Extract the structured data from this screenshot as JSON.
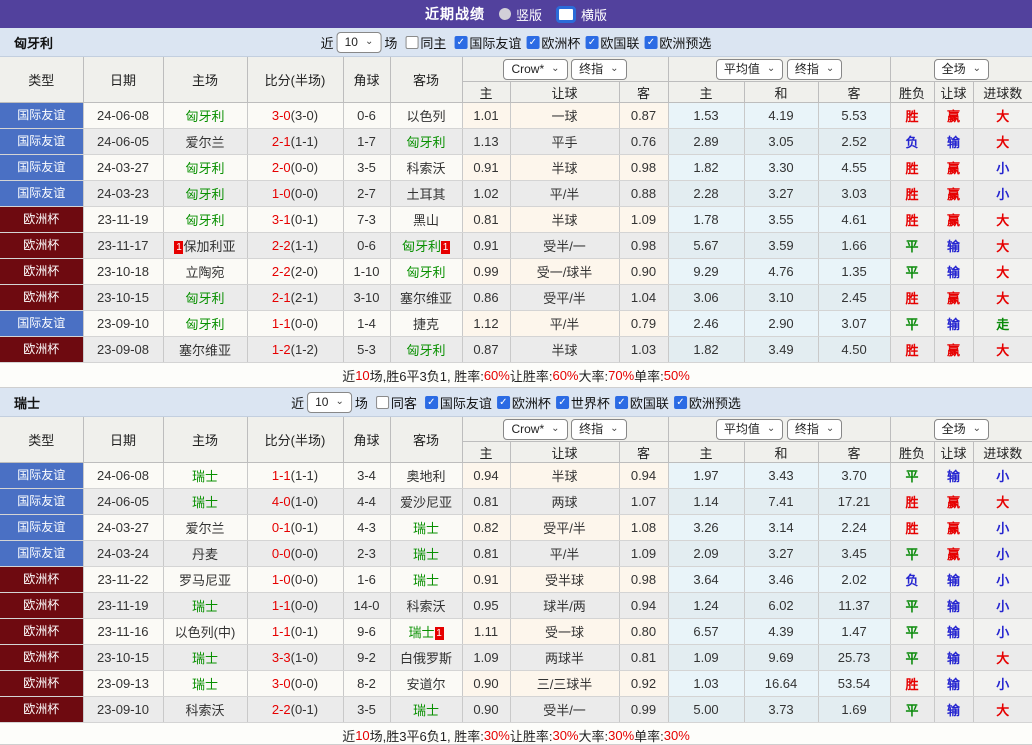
{
  "topbar": {
    "title": "近期战绩",
    "radio_vertical": "竖版",
    "radio_horizontal": "横版",
    "selected": "横版"
  },
  "colors": {
    "topbar_purple": "#52419d",
    "filter_bg": "#dbe5f2",
    "badge_friendly_blue": "#4a70c4",
    "badge_eurocup_darkred": "#6e0a10",
    "win_red": "#e60000",
    "lose_blue": "#2525d0",
    "draw_green": "#0a8a0a",
    "team_green": "#089000",
    "avg_col_blue": "#e9f4f9"
  },
  "header_labels": {
    "static_cols": [
      "类型",
      "日期",
      "主场",
      "比分(半场)",
      "角球",
      "客场"
    ],
    "crow_select": "Crow*",
    "crow_final_select": "终指",
    "crow_subcols": [
      "主",
      "让球",
      "客"
    ],
    "avg_select": "平均值",
    "avg_final_select": "终指",
    "avg_subcols": [
      "主",
      "和",
      "客"
    ],
    "full_select": "全场",
    "result_subcols": [
      "胜负",
      "让球",
      "进球数"
    ]
  },
  "sections": [
    {
      "team": "匈牙利",
      "filter": {
        "near_label": "近",
        "count_value": "10",
        "games_label": "场",
        "same_label": "同主",
        "same_checked": false,
        "competitions": [
          "国际友谊",
          "欧洲杯",
          "欧国联",
          "欧洲预选"
        ]
      },
      "rows": [
        {
          "type": "国际友谊",
          "style": "blue",
          "date": "24-06-08",
          "home": "匈牙利",
          "home_green": true,
          "home_card": "",
          "score": "3-0",
          "half": "(3-0)",
          "corner": "0-6",
          "away": "以色列",
          "away_green": false,
          "away_card": "",
          "crow": [
            "1.01",
            "一球",
            "0.87"
          ],
          "avg": [
            "1.53",
            "4.19",
            "5.53"
          ],
          "results": [
            [
              "胜",
              "r"
            ],
            [
              "赢",
              "r"
            ],
            [
              "大",
              "r"
            ]
          ]
        },
        {
          "type": "国际友谊",
          "style": "blue",
          "date": "24-06-05",
          "home": "爱尔兰",
          "home_green": false,
          "home_card": "",
          "score": "2-1",
          "half": "(1-1)",
          "corner": "1-7",
          "away": "匈牙利",
          "away_green": true,
          "away_card": "",
          "crow": [
            "1.13",
            "平手",
            "0.76"
          ],
          "avg": [
            "2.89",
            "3.05",
            "2.52"
          ],
          "results": [
            [
              "负",
              "b"
            ],
            [
              "输",
              "b"
            ],
            [
              "大",
              "r"
            ]
          ]
        },
        {
          "type": "国际友谊",
          "style": "blue",
          "date": "24-03-27",
          "home": "匈牙利",
          "home_green": true,
          "home_card": "",
          "score": "2-0",
          "half": "(0-0)",
          "corner": "3-5",
          "away": "科索沃",
          "away_green": false,
          "away_card": "",
          "crow": [
            "0.91",
            "半球",
            "0.98"
          ],
          "avg": [
            "1.82",
            "3.30",
            "4.55"
          ],
          "results": [
            [
              "胜",
              "r"
            ],
            [
              "赢",
              "r"
            ],
            [
              "小",
              "b"
            ]
          ]
        },
        {
          "type": "国际友谊",
          "style": "blue",
          "date": "24-03-23",
          "home": "匈牙利",
          "home_green": true,
          "home_card": "",
          "score": "1-0",
          "half": "(0-0)",
          "corner": "2-7",
          "away": "土耳其",
          "away_green": false,
          "away_card": "",
          "crow": [
            "1.02",
            "平/半",
            "0.88"
          ],
          "avg": [
            "2.28",
            "3.27",
            "3.03"
          ],
          "results": [
            [
              "胜",
              "r"
            ],
            [
              "赢",
              "r"
            ],
            [
              "小",
              "b"
            ]
          ]
        },
        {
          "type": "欧洲杯",
          "style": "darkred",
          "date": "23-11-19",
          "home": "匈牙利",
          "home_green": true,
          "home_card": "",
          "score": "3-1",
          "half": "(0-1)",
          "corner": "7-3",
          "away": "黑山",
          "away_green": false,
          "away_card": "",
          "crow": [
            "0.81",
            "半球",
            "1.09"
          ],
          "avg": [
            "1.78",
            "3.55",
            "4.61"
          ],
          "results": [
            [
              "胜",
              "r"
            ],
            [
              "赢",
              "r"
            ],
            [
              "大",
              "r"
            ]
          ]
        },
        {
          "type": "欧洲杯",
          "style": "darkred",
          "date": "23-11-17",
          "home": "保加利亚",
          "home_green": false,
          "home_card": "1",
          "score": "2-2",
          "half": "(1-1)",
          "corner": "0-6",
          "away": "匈牙利",
          "away_green": true,
          "away_card": "1",
          "crow": [
            "0.91",
            "受半/一",
            "0.98"
          ],
          "avg": [
            "5.67",
            "3.59",
            "1.66"
          ],
          "results": [
            [
              "平",
              "g"
            ],
            [
              "输",
              "b"
            ],
            [
              "大",
              "r"
            ]
          ]
        },
        {
          "type": "欧洲杯",
          "style": "darkred",
          "date": "23-10-18",
          "home": "立陶宛",
          "home_green": false,
          "home_card": "",
          "score": "2-2",
          "half": "(2-0)",
          "corner": "1-10",
          "away": "匈牙利",
          "away_green": true,
          "away_card": "",
          "crow": [
            "0.99",
            "受一/球半",
            "0.90"
          ],
          "avg": [
            "9.29",
            "4.76",
            "1.35"
          ],
          "results": [
            [
              "平",
              "g"
            ],
            [
              "输",
              "b"
            ],
            [
              "大",
              "r"
            ]
          ]
        },
        {
          "type": "欧洲杯",
          "style": "darkred",
          "date": "23-10-15",
          "home": "匈牙利",
          "home_green": true,
          "home_card": "",
          "score": "2-1",
          "half": "(2-1)",
          "corner": "3-10",
          "away": "塞尔维亚",
          "away_green": false,
          "away_card": "",
          "crow": [
            "0.86",
            "受平/半",
            "1.04"
          ],
          "avg": [
            "3.06",
            "3.10",
            "2.45"
          ],
          "results": [
            [
              "胜",
              "r"
            ],
            [
              "赢",
              "r"
            ],
            [
              "大",
              "r"
            ]
          ]
        },
        {
          "type": "国际友谊",
          "style": "blue",
          "date": "23-09-10",
          "home": "匈牙利",
          "home_green": true,
          "home_card": "",
          "score": "1-1",
          "half": "(0-0)",
          "corner": "1-4",
          "away": "捷克",
          "away_green": false,
          "away_card": "",
          "crow": [
            "1.12",
            "平/半",
            "0.79"
          ],
          "avg": [
            "2.46",
            "2.90",
            "3.07"
          ],
          "results": [
            [
              "平",
              "g"
            ],
            [
              "输",
              "b"
            ],
            [
              "走",
              "g"
            ]
          ]
        },
        {
          "type": "欧洲杯",
          "style": "darkred",
          "date": "23-09-08",
          "home": "塞尔维亚",
          "home_green": false,
          "home_card": "",
          "score": "1-2",
          "half": "(1-2)",
          "corner": "5-3",
          "away": "匈牙利",
          "away_green": true,
          "away_card": "",
          "crow": [
            "0.87",
            "半球",
            "1.03"
          ],
          "avg": [
            "1.82",
            "3.49",
            "4.50"
          ],
          "results": [
            [
              "胜",
              "r"
            ],
            [
              "赢",
              "r"
            ],
            [
              "大",
              "r"
            ]
          ]
        }
      ],
      "summary": [
        [
          "近",
          0
        ],
        [
          "10",
          1
        ],
        [
          "场,胜6平3负1, 胜率:",
          0
        ],
        [
          "60%",
          1
        ],
        [
          " 让胜率:",
          0
        ],
        [
          "60%",
          1
        ],
        [
          " 大率:",
          0
        ],
        [
          "70%",
          1
        ],
        [
          " 单率:",
          0
        ],
        [
          "50%",
          1
        ]
      ]
    },
    {
      "team": "瑞士",
      "filter": {
        "near_label": "近",
        "count_value": "10",
        "games_label": "场",
        "same_label": "同客",
        "same_checked": false,
        "competitions": [
          "国际友谊",
          "欧洲杯",
          "世界杯",
          "欧国联",
          "欧洲预选"
        ]
      },
      "rows": [
        {
          "type": "国际友谊",
          "style": "blue",
          "date": "24-06-08",
          "home": "瑞士",
          "home_green": true,
          "home_card": "",
          "score": "1-1",
          "half": "(1-1)",
          "corner": "3-4",
          "away": "奥地利",
          "away_green": false,
          "away_card": "",
          "crow": [
            "0.94",
            "半球",
            "0.94"
          ],
          "avg": [
            "1.97",
            "3.43",
            "3.70"
          ],
          "results": [
            [
              "平",
              "g"
            ],
            [
              "输",
              "b"
            ],
            [
              "小",
              "b"
            ]
          ]
        },
        {
          "type": "国际友谊",
          "style": "blue",
          "date": "24-06-05",
          "home": "瑞士",
          "home_green": true,
          "home_card": "",
          "score": "4-0",
          "half": "(1-0)",
          "corner": "4-4",
          "away": "爱沙尼亚",
          "away_green": false,
          "away_card": "",
          "crow": [
            "0.81",
            "两球",
            "1.07"
          ],
          "avg": [
            "1.14",
            "7.41",
            "17.21"
          ],
          "results": [
            [
              "胜",
              "r"
            ],
            [
              "赢",
              "r"
            ],
            [
              "大",
              "r"
            ]
          ]
        },
        {
          "type": "国际友谊",
          "style": "blue",
          "date": "24-03-27",
          "home": "爱尔兰",
          "home_green": false,
          "home_card": "",
          "score": "0-1",
          "half": "(0-1)",
          "corner": "4-3",
          "away": "瑞士",
          "away_green": true,
          "away_card": "",
          "crow": [
            "0.82",
            "受平/半",
            "1.08"
          ],
          "avg": [
            "3.26",
            "3.14",
            "2.24"
          ],
          "results": [
            [
              "胜",
              "r"
            ],
            [
              "赢",
              "r"
            ],
            [
              "小",
              "b"
            ]
          ]
        },
        {
          "type": "国际友谊",
          "style": "blue",
          "date": "24-03-24",
          "home": "丹麦",
          "home_green": false,
          "home_card": "",
          "score": "0-0",
          "half": "(0-0)",
          "corner": "2-3",
          "away": "瑞士",
          "away_green": true,
          "away_card": "",
          "crow": [
            "0.81",
            "平/半",
            "1.09"
          ],
          "avg": [
            "2.09",
            "3.27",
            "3.45"
          ],
          "results": [
            [
              "平",
              "g"
            ],
            [
              "赢",
              "r"
            ],
            [
              "小",
              "b"
            ]
          ]
        },
        {
          "type": "欧洲杯",
          "style": "darkred",
          "date": "23-11-22",
          "home": "罗马尼亚",
          "home_green": false,
          "home_card": "",
          "score": "1-0",
          "half": "(0-0)",
          "corner": "1-6",
          "away": "瑞士",
          "away_green": true,
          "away_card": "",
          "crow": [
            "0.91",
            "受半球",
            "0.98"
          ],
          "avg": [
            "3.64",
            "3.46",
            "2.02"
          ],
          "results": [
            [
              "负",
              "b"
            ],
            [
              "输",
              "b"
            ],
            [
              "小",
              "b"
            ]
          ]
        },
        {
          "type": "欧洲杯",
          "style": "darkred",
          "date": "23-11-19",
          "home": "瑞士",
          "home_green": true,
          "home_card": "",
          "score": "1-1",
          "half": "(0-0)",
          "corner": "14-0",
          "away": "科索沃",
          "away_green": false,
          "away_card": "",
          "crow": [
            "0.95",
            "球半/两",
            "0.94"
          ],
          "avg": [
            "1.24",
            "6.02",
            "11.37"
          ],
          "results": [
            [
              "平",
              "g"
            ],
            [
              "输",
              "b"
            ],
            [
              "小",
              "b"
            ]
          ]
        },
        {
          "type": "欧洲杯",
          "style": "darkred",
          "date": "23-11-16",
          "home": "以色列(中)",
          "home_green": false,
          "home_card": "",
          "score": "1-1",
          "half": "(0-1)",
          "corner": "9-6",
          "away": "瑞士",
          "away_green": true,
          "away_card": "1",
          "crow": [
            "1.11",
            "受一球",
            "0.80"
          ],
          "avg": [
            "6.57",
            "4.39",
            "1.47"
          ],
          "results": [
            [
              "平",
              "g"
            ],
            [
              "输",
              "b"
            ],
            [
              "小",
              "b"
            ]
          ]
        },
        {
          "type": "欧洲杯",
          "style": "darkred",
          "date": "23-10-15",
          "home": "瑞士",
          "home_green": true,
          "home_card": "",
          "score": "3-3",
          "half": "(1-0)",
          "corner": "9-2",
          "away": "白俄罗斯",
          "away_green": false,
          "away_card": "",
          "crow": [
            "1.09",
            "两球半",
            "0.81"
          ],
          "avg": [
            "1.09",
            "9.69",
            "25.73"
          ],
          "results": [
            [
              "平",
              "g"
            ],
            [
              "输",
              "b"
            ],
            [
              "大",
              "r"
            ]
          ]
        },
        {
          "type": "欧洲杯",
          "style": "darkred",
          "date": "23-09-13",
          "home": "瑞士",
          "home_green": true,
          "home_card": "",
          "score": "3-0",
          "half": "(0-0)",
          "corner": "8-2",
          "away": "安道尔",
          "away_green": false,
          "away_card": "",
          "crow": [
            "0.90",
            "三/三球半",
            "0.92"
          ],
          "avg": [
            "1.03",
            "16.64",
            "53.54"
          ],
          "results": [
            [
              "胜",
              "r"
            ],
            [
              "输",
              "b"
            ],
            [
              "小",
              "b"
            ]
          ]
        },
        {
          "type": "欧洲杯",
          "style": "darkred",
          "date": "23-09-10",
          "home": "科索沃",
          "home_green": false,
          "home_card": "",
          "score": "2-2",
          "half": "(0-1)",
          "corner": "3-5",
          "away": "瑞士",
          "away_green": true,
          "away_card": "",
          "crow": [
            "0.90",
            "受半/一",
            "0.99"
          ],
          "avg": [
            "5.00",
            "3.73",
            "1.69"
          ],
          "results": [
            [
              "平",
              "g"
            ],
            [
              "输",
              "b"
            ],
            [
              "大",
              "r"
            ]
          ]
        }
      ],
      "summary": [
        [
          "近",
          0
        ],
        [
          "10",
          1
        ],
        [
          "场,胜3平6负1, 胜率:",
          0
        ],
        [
          "30%",
          1
        ],
        [
          " 让胜率:",
          0
        ],
        [
          "30%",
          1
        ],
        [
          " 大率:",
          0
        ],
        [
          "30%",
          1
        ],
        [
          " 单率:",
          0
        ],
        [
          "30%",
          1
        ]
      ]
    }
  ]
}
